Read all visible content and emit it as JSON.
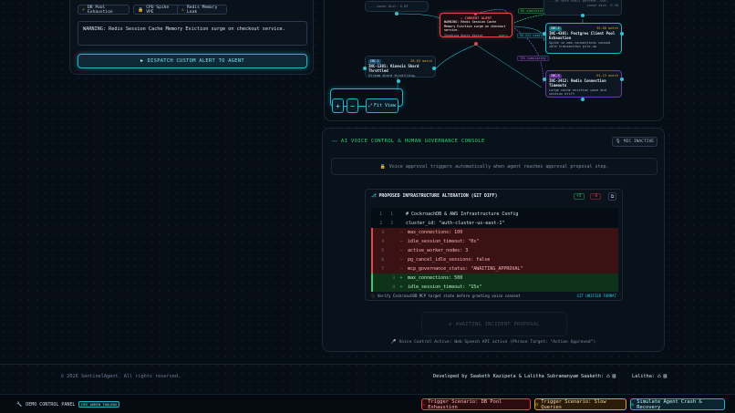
{
  "left_panel": {
    "header_cut": "…",
    "chips": [
      {
        "icon": "⚡",
        "label": "DB Pool Exhaustion"
      },
      {
        "icon": "🔒",
        "label": "CPU Spike VPE"
      },
      {
        "icon": "⚠",
        "label": "Redis Memory Leak"
      }
    ],
    "alert_text": "WARNING: Redis Session Cache Memory Eviction surge on checkout service.",
    "dispatch_label": "DISPATCH CUSTOM ALERT TO AGENT"
  },
  "graph": {
    "current_alert": {
      "title": "CURRENT ALERT",
      "body": "WARNING: Redis Session Cache Memory Eviction surge on checkout service.",
      "meta_left": "Invoking Query Vector",
      "meta_right": "query"
    },
    "edge_labels": [
      "0% similarity",
      "95.22% similarity",
      "72% similarity"
    ],
    "node_left": {
      "badge": "INC-1",
      "pct": "36.03 match",
      "title": "INC-1301: Kinesis Shard Throttled",
      "sub": "Stream shard throttling…"
    },
    "node_right1": {
      "badge": "INC-4",
      "pct": "95.88 match",
      "title": "INC-4301: Postgres Client Pool Exhaustion",
      "sub": "Spike in max connections caused idle transaction pile-up"
    },
    "node_right2": {
      "badge": "INC-3",
      "pct": "61.23 match",
      "title": "INC-3412: Redis Connection Timeouts",
      "sub": "Large cache eviction wave and session drift"
    },
    "controls": {
      "zoom_in": "+",
      "zoom_out": "−",
      "fit": "Fit View"
    }
  },
  "voice": {
    "title": "AI VOICE CONTROL & HUMAN GOVERNANCE CONSOLE",
    "mic_badge": "MIC INACTIVE",
    "info": "Voice approval triggers automatically when agent reaches approval proposal step."
  },
  "diff": {
    "title": "PROPOSED INFRASTRUCTURE ALTERATION (GIT DIFF)",
    "plus": "+5",
    "minus": "−6",
    "rows": [
      {
        "n1": "1",
        "n2": "1",
        "sign": "",
        "text": "# CockroachDB & AWS Infrastructure Config",
        "type": "ctx"
      },
      {
        "n1": "2",
        "n2": "2",
        "sign": "",
        "text": "cluster_id: \"auth-cluster-us-east-1\"",
        "type": "ctx"
      },
      {
        "n1": "3",
        "n2": "",
        "sign": "−",
        "text": "max_connections: 100",
        "type": "del"
      },
      {
        "n1": "4",
        "n2": "",
        "sign": "−",
        "text": "idle_session_timeout: \"0s\"",
        "type": "del"
      },
      {
        "n1": "5",
        "n2": "",
        "sign": "−",
        "text": "active_worker_nodes: 3",
        "type": "del"
      },
      {
        "n1": "6",
        "n2": "",
        "sign": "−",
        "text": "pg_cancel_idle_sessions: false",
        "type": "del"
      },
      {
        "n1": "7",
        "n2": "",
        "sign": "−",
        "text": "mcp_governance_status: \"AWAITING_APPROVAL\"",
        "type": "del"
      },
      {
        "n1": "",
        "n2": "3",
        "sign": "+",
        "text": "max_connections: 500",
        "type": "add"
      },
      {
        "n1": "",
        "n2": "4",
        "sign": "+",
        "text": "idle_session_timeout: \"15s\"",
        "type": "add"
      }
    ],
    "footer_left": "Verify CockroachDB MCP target state before granting voice consent",
    "footer_right": "GIT UNIFIED FORMAT"
  },
  "awaiting_button": "AWAITING INCIDENT PROPOSAL",
  "voice_status": "Voice Control Active: Web Speech API active (Phrase Target: \"Action Approved\")",
  "footer": {
    "copyright": "© 2026 SentinelAgent. All rights reserved.",
    "developed": "Developed by Saaketh Kazipeta & Lalitha Subramanyam",
    "saaketh": "Saaketh:",
    "lalitha": "Lalitha:"
  },
  "demo": {
    "label": "DEMO CONTROL PANEL",
    "badge": "DEV ADMIN TOOLBOX",
    "btn1": "Trigger Scenario: DB Pool Exhaustion",
    "btn2": "Trigger Scenario: Slow Queries",
    "btn3": "Simulate Agent Crash & Recovery"
  },
  "colors": {
    "accent": "#1fb6c9",
    "danger": "#e04848",
    "warn": "#e0a030",
    "ok": "#2ecc71"
  }
}
